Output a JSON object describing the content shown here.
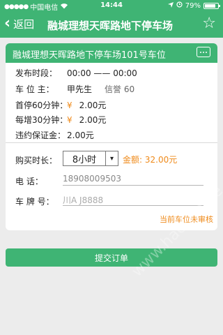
{
  "status": {
    "carrier": "中国电信",
    "time": "14:44",
    "battery": "79%"
  },
  "nav": {
    "back_label": "返回",
    "title": "融城理想天晖路地下停车场"
  },
  "card": {
    "title": "融城理想天晖路地下停车场101号车位"
  },
  "details": {
    "publish_label": "发布时段：",
    "publish_value": "00:00 —— 00:00",
    "owner_label": "车 位 主：",
    "owner_value": "甲先生",
    "credit": "信誉 60",
    "first_label": "首停60分钟：",
    "first_value": "2.00元",
    "add_label": "每增30分钟：",
    "add_value": "2.00元",
    "deposit_label": "违约保证金：",
    "deposit_value": "2.00元",
    "currency": "¥"
  },
  "form": {
    "duration_label": "购买时长：",
    "duration_value": "8小时",
    "amount_text": "金额: 32.00元",
    "phone_label": "电    话：",
    "phone_value": "18908009503",
    "plate_label": "车 牌 号：",
    "plate_placeholder": "川A J8888"
  },
  "notice": "当前车位未审核",
  "submit_label": "提交订单",
  "watermark": "www.hackhome.com",
  "colors": {
    "accent": "#3fb474",
    "highlight": "#ef8a1a",
    "background": "#ececec"
  }
}
